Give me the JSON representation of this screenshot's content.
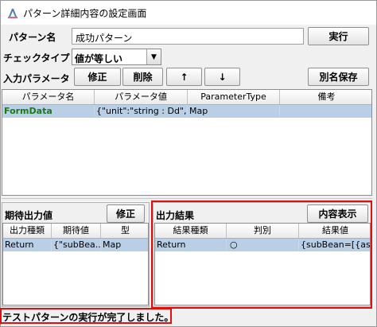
{
  "window": {
    "title": "パターン詳細内容の設定画面"
  },
  "form": {
    "pattern_name_label": "パターン名",
    "pattern_name_value": "成功パターン",
    "run_button": "実行",
    "check_type_label": "チェックタイプ",
    "check_type_value": "値が等しい",
    "input_param_label": "入力パラメータ",
    "edit_button": "修正",
    "delete_button": "削除",
    "up_button": "↑",
    "down_button": "↓",
    "save_as_button": "別名保存"
  },
  "param_table": {
    "columns": [
      "パラメータ名",
      "パラメータ値",
      "ParameterType",
      "備考"
    ],
    "rows": [
      {
        "name": "FormData",
        "value": "{\"unit\":\"string : Dd\",\"...",
        "type": "Map",
        "note": ""
      }
    ]
  },
  "expected_panel": {
    "title": "期待出力値",
    "edit_button": "修正",
    "columns": [
      "出力種類",
      "期待値",
      "型"
    ],
    "rows": [
      {
        "kind": "Return",
        "expected": "{\"subBea...",
        "type": "Map"
      }
    ]
  },
  "result_panel": {
    "title": "出力結果",
    "show_button": "内容表示",
    "columns": [
      "結果種類",
      "判別",
      "結果値"
    ],
    "rows": [
      {
        "kind": "Return",
        "judge": "○",
        "value": "{subBean=[{as..."
      }
    ]
  },
  "status": {
    "message": "テストパターンの実行が完了しました。"
  },
  "colors": {
    "highlight": "#e01010",
    "row_selected": "#b8cfe5",
    "param_name": "#1a7a1a"
  }
}
